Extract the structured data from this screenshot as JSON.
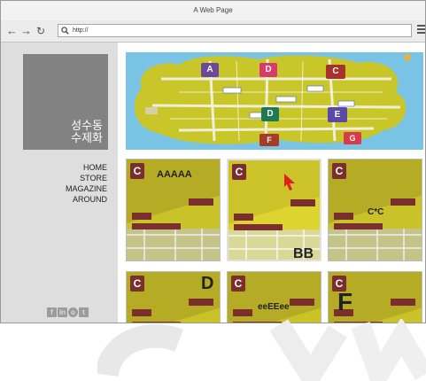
{
  "window": {
    "title": "A Web Page"
  },
  "toolbar": {
    "url": "http://"
  },
  "sidebar": {
    "logo_line1": "성수동",
    "logo_line2": "수제화",
    "nav": [
      "HOME",
      "STORE",
      "MAGAZINE",
      "AROUND"
    ],
    "social": [
      "facebook-icon",
      "linkedin-icon",
      "instagram-icon",
      "twitter-icon"
    ]
  },
  "hero": {
    "markers": [
      "A",
      "D",
      "C",
      "D",
      "E",
      "F",
      "G"
    ],
    "colors": {
      "sky": "#79c3e4",
      "land": "#c9c62a"
    }
  },
  "cards": [
    {
      "label": "AAAAA",
      "badge": "C"
    },
    {
      "label": "BB",
      "badge": "C"
    },
    {
      "label": "C*C",
      "badge": "C"
    },
    {
      "label": "D",
      "badge": "C"
    },
    {
      "label": "eeEEee",
      "badge": "C"
    },
    {
      "label": "F",
      "badge": "C"
    }
  ]
}
